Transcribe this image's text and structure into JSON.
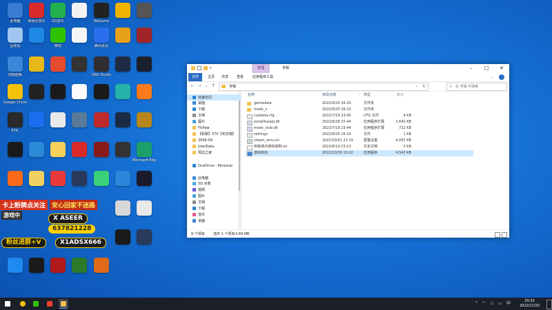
{
  "desktop": {
    "icons": [
      {
        "label": "此电脑",
        "color": "#3a7bd5"
      },
      {
        "label": "网易云音乐",
        "color": "#d92b2b"
      },
      {
        "label": "QQ音乐",
        "color": "#23b14d"
      },
      {
        "label": "",
        "color": "#f2f2f2"
      },
      {
        "label": "WeGame",
        "color": "#222222"
      },
      {
        "label": "",
        "color": "#f0b400"
      },
      {
        "label": "",
        "color": "#555555"
      },
      {
        "label": "回收站",
        "color": "#9ec6f0"
      },
      {
        "label": "",
        "color": "#1e88e5"
      },
      {
        "label": "微信",
        "color": "#2dc100"
      },
      {
        "label": "",
        "color": "#f5f5f5"
      },
      {
        "label": "腾讯会议",
        "color": "#2a6ff0"
      },
      {
        "label": "",
        "color": "#e8a21a"
      },
      {
        "label": "",
        "color": "#a0252a"
      },
      {
        "label": "控制面板",
        "color": "#3a86d8"
      },
      {
        "label": "",
        "color": "#e7b918"
      },
      {
        "label": "",
        "color": "#e64a2e"
      },
      {
        "label": "",
        "color": "#333333"
      },
      {
        "label": "OBS Studio",
        "color": "#302e31"
      },
      {
        "label": "",
        "color": "#1f2a44"
      },
      {
        "label": "",
        "color": "#1a1f2e"
      },
      {
        "label": "Google Chrome",
        "color": "#f4c20d"
      },
      {
        "label": "",
        "color": "#222222"
      },
      {
        "label": "",
        "color": "#1b1b1b"
      },
      {
        "label": "",
        "color": "#fbfbfb"
      },
      {
        "label": "",
        "color": "#1a1a1a"
      },
      {
        "label": "",
        "color": "#24b3a8"
      },
      {
        "label": "",
        "color": "#ff7a1a"
      },
      {
        "label": "EPIC",
        "color": "#2a2a2a"
      },
      {
        "label": "",
        "color": "#1a6ff0"
      },
      {
        "label": "",
        "color": "#e9e9e9"
      },
      {
        "label": "",
        "color": "#5a7a9a"
      },
      {
        "label": "",
        "color": "#c12a2a"
      },
      {
        "label": "",
        "color": "#1a2a44"
      },
      {
        "label": "",
        "color": "#b8861a"
      },
      {
        "label": "",
        "color": "#1a1a1a"
      },
      {
        "label": "",
        "color": "#2a8ad8"
      },
      {
        "label": "",
        "color": "#f7d15a"
      },
      {
        "label": "",
        "color": "#d82a2a"
      },
      {
        "label": "",
        "color": "#8a1a1a"
      },
      {
        "label": "",
        "color": "#333333"
      },
      {
        "label": "Microsoft Edge",
        "color": "#1ba06a"
      },
      {
        "label": "",
        "color": "#ff6a1a"
      },
      {
        "label": "",
        "color": "#f0d060"
      },
      {
        "label": "",
        "color": "#e83a3a"
      },
      {
        "label": "",
        "color": "#2a3a5a"
      },
      {
        "label": "",
        "color": "#3ad07a"
      },
      {
        "label": "",
        "color": "#2a86d8"
      },
      {
        "label": "",
        "color": "#1a1a2a"
      },
      {
        "label": "",
        "color": "#d8d8d8"
      },
      {
        "label": "",
        "color": "#e8e8e8"
      },
      {
        "label": "",
        "color": "#1a1a1a"
      },
      {
        "label": "",
        "color": "#2a3a5a"
      },
      {
        "label": "",
        "color": "#1e8af0"
      },
      {
        "label": "",
        "color": "#1a1a1a"
      },
      {
        "label": "",
        "color": "#b01a1a"
      },
      {
        "label": "",
        "color": "#2a7a2a"
      },
      {
        "label": "",
        "color": "#e06a1a"
      }
    ]
  },
  "promo": {
    "line1": "卡上粉牌点关注",
    "line1b": "安心回家不迷路",
    "live": "游戏中",
    "id_prefix": "X",
    "id_name": "ASEER",
    "qq": "637821228",
    "group": "粉丝进群+V",
    "wechat": "X1ADSX666"
  },
  "explorer": {
    "title": "专辑",
    "context_tab": "管理",
    "ribbon_tabs": [
      "文件",
      "主页",
      "共享",
      "查看",
      "应用程序工具"
    ],
    "address": "专辑",
    "search_placeholder": "在 专辑 中搜索",
    "nav": [
      {
        "label": "快速访问",
        "kind": "star",
        "indent": 0
      },
      {
        "label": "桌面",
        "kind": "folder-blue",
        "indent": 1
      },
      {
        "label": "下载",
        "kind": "download",
        "indent": 1
      },
      {
        "label": "文档",
        "kind": "doc",
        "indent": 1
      },
      {
        "label": "图片",
        "kind": "pic",
        "indent": 1
      },
      {
        "label": "FicPaw",
        "kind": "folder",
        "indent": 1
      },
      {
        "label": "【秋梨】570【天灾城】",
        "kind": "folder",
        "indent": 1
      },
      {
        "label": "2006-09",
        "kind": "folder",
        "indent": 1
      },
      {
        "label": "UserData",
        "kind": "folder",
        "indent": 1
      },
      {
        "label": "周边之家",
        "kind": "folder",
        "indent": 1
      },
      {
        "label": "",
        "kind": "none",
        "indent": 0
      },
      {
        "label": "OneDrive - Personal",
        "kind": "cloud",
        "indent": 0
      },
      {
        "label": "",
        "kind": "none",
        "indent": 0
      },
      {
        "label": "此电脑",
        "kind": "pc",
        "indent": 0
      },
      {
        "label": "3D 对象",
        "kind": "3d",
        "indent": 1
      },
      {
        "label": "视频",
        "kind": "video",
        "indent": 1
      },
      {
        "label": "图片",
        "kind": "pic",
        "indent": 1
      },
      {
        "label": "文档",
        "kind": "doc",
        "indent": 1
      },
      {
        "label": "下载",
        "kind": "download",
        "indent": 1
      },
      {
        "label": "音乐",
        "kind": "music",
        "indent": 1
      },
      {
        "label": "桌面",
        "kind": "folder-blue",
        "indent": 1
      }
    ],
    "columns": {
      "name": "名称",
      "date": "修改日期",
      "type": "类型",
      "size": "大小"
    },
    "files": [
      {
        "name": "gamedata",
        "date": "2022/9/20 16:20",
        "type": "文件夹",
        "size": "",
        "kind": "folder",
        "selected": false
      },
      {
        "name": "mods_x",
        "date": "2022/9/20 16:20",
        "type": "文件夹",
        "size": "",
        "kind": "folder",
        "selected": false
      },
      {
        "name": "cuedata.cfg",
        "date": "2022/7/19 23:45",
        "type": "CFG 文件",
        "size": "4 KB",
        "kind": "file",
        "selected": false
      },
      {
        "name": "exrwlliveapi.dll",
        "date": "2022/9/26 15:44",
        "type": "应用程序扩展",
        "size": "2,642 KB",
        "kind": "dll",
        "selected": false
      },
      {
        "name": "mods_stub.dll",
        "date": "2022/7/19 23:44",
        "type": "应用程序扩展",
        "size": "722 KB",
        "kind": "dll",
        "selected": false
      },
      {
        "name": "settings",
        "date": "2022/9/25 16:10",
        "type": "文件",
        "size": "1 KB",
        "kind": "file",
        "selected": false
      },
      {
        "name": "steam_emu.ini",
        "date": "2022/10/31 22:19",
        "type": "配置设置",
        "size": "4,097 KB",
        "kind": "ini",
        "selected": false
      },
      {
        "name": "秋梨城点游戏说明.txt",
        "date": "2022/8/14 23:13",
        "type": "文本文档",
        "size": "3 KB",
        "kind": "txt",
        "selected": false
      },
      {
        "name": "游戏启动",
        "date": "2022/10/30 10:22",
        "type": "应用程序",
        "size": "4,543 KB",
        "kind": "exe",
        "selected": true
      }
    ],
    "status": {
      "items": "9 个项目",
      "selected": "选中 1 个项目",
      "size": "3.84 MB"
    }
  },
  "taskbar": {
    "apps": [
      {
        "name": "start-icon",
        "color": "#ffffff",
        "active": false
      },
      {
        "name": "chrome-taskbar-icon",
        "color": "#f4c20d",
        "active": false
      },
      {
        "name": "wechat-taskbar-icon",
        "color": "#2dc100",
        "active": false
      },
      {
        "name": "app-taskbar-icon",
        "color": "#e8402a",
        "active": false
      },
      {
        "name": "file-explorer-taskbar-icon",
        "color": "#f2c14e",
        "active": true
      }
    ],
    "tray_arrow": "^",
    "tray_lang": "中",
    "time": "20:33",
    "date": "2022/11/20"
  }
}
